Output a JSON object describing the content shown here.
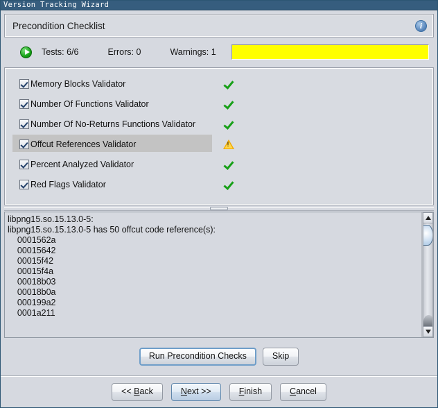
{
  "window": {
    "title": "Version Tracking Wizard"
  },
  "header": {
    "title": "Precondition Checklist",
    "info_icon": "info-icon",
    "info_glyph": "i"
  },
  "status": {
    "run_icon": "play-icon",
    "tests_label": "Tests: 6/6",
    "errors_label": "Errors: 0",
    "warnings_label": "Warnings: 1",
    "warning_field_value": "",
    "warning_field_color": "#ffff00"
  },
  "checklist": {
    "items": [
      {
        "label": "Memory Blocks Validator",
        "checked": true,
        "status": "ok",
        "selected": false
      },
      {
        "label": "Number Of Functions Validator",
        "checked": true,
        "status": "ok",
        "selected": false
      },
      {
        "label": "Number Of No-Returns Functions Validator",
        "checked": true,
        "status": "ok",
        "selected": false
      },
      {
        "label": "Offcut References Validator",
        "checked": true,
        "status": "warning",
        "selected": true
      },
      {
        "label": "Percent Analyzed Validator",
        "checked": true,
        "status": "ok",
        "selected": false
      },
      {
        "label": "Red Flags Validator",
        "checked": true,
        "status": "ok",
        "selected": false
      }
    ],
    "ok_icon": "green-check-icon",
    "warning_icon": "warning-triangle-icon"
  },
  "log": {
    "lines": [
      "libpng15.so.15.13.0-5:",
      "libpng15.so.15.13.0-5 has 50 offcut code reference(s):",
      "    0001562a",
      "    00015642",
      "    00015f42",
      "    00015f4a",
      "    00018b03",
      "    00018b0a",
      "    000199a2",
      "    0001a211"
    ],
    "scroll_up_icon": "scroll-up-arrow-icon",
    "scroll_down_icon": "scroll-down-arrow-icon"
  },
  "actions": {
    "run_checks_label": "Run Precondition Checks",
    "skip_label": "Skip"
  },
  "nav": {
    "back_label": "<< Back",
    "back_mnemonic": "B",
    "next_label": "Next >>",
    "next_mnemonic": "N",
    "finish_label": "Finish",
    "finish_mnemonic": "F",
    "cancel_label": "Cancel",
    "cancel_mnemonic": "C"
  },
  "colors": {
    "titlebar": "#365d7e",
    "panel": "#d6d9e0",
    "warning_yellow": "#ffff00",
    "ok_green": "#18a018",
    "warn_orange": "#f0a800",
    "selection_gray": "#c3c3c3"
  }
}
